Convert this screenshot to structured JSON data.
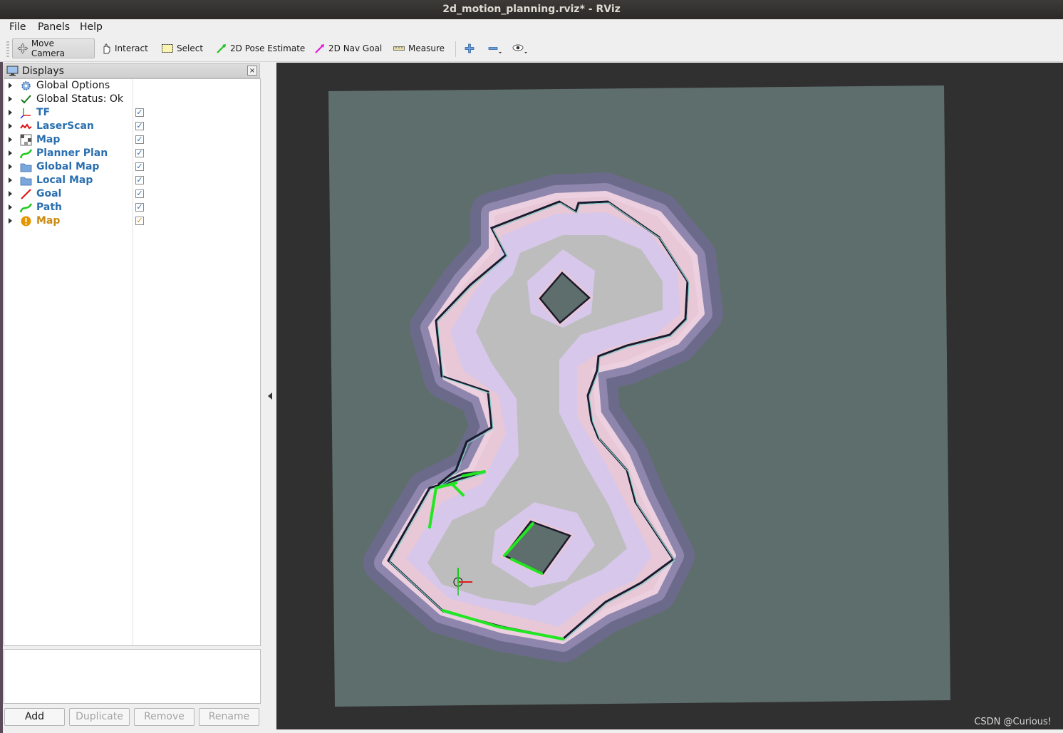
{
  "window": {
    "title": "2d_motion_planning.rviz* - RViz"
  },
  "menu": [
    {
      "label": "File"
    },
    {
      "label": "Panels"
    },
    {
      "label": "Help"
    }
  ],
  "toolbar": {
    "move_camera": "Move Camera",
    "interact": "Interact",
    "select": "Select",
    "pose_estimate": "2D Pose Estimate",
    "nav_goal": "2D Nav Goal",
    "measure": "Measure"
  },
  "displays": {
    "title": "Displays",
    "close": "×",
    "items": [
      {
        "label": "Global Options",
        "icon": "gear-icon",
        "checkbox": false,
        "style": "plain"
      },
      {
        "label": "Global Status: Ok",
        "icon": "check-icon",
        "checkbox": false,
        "style": "plain"
      },
      {
        "label": "TF",
        "icon": "tf-axes-icon",
        "checkbox": true,
        "checked": true,
        "style": "link"
      },
      {
        "label": "LaserScan",
        "icon": "laserscan-icon",
        "checkbox": true,
        "checked": true,
        "style": "link"
      },
      {
        "label": "Map",
        "icon": "map-icon",
        "checkbox": true,
        "checked": true,
        "style": "link"
      },
      {
        "label": "Planner Plan",
        "icon": "path-icon",
        "checkbox": true,
        "checked": true,
        "style": "link"
      },
      {
        "label": "Global Map",
        "icon": "folder-icon",
        "checkbox": true,
        "checked": true,
        "style": "link"
      },
      {
        "label": "Local Map",
        "icon": "folder-icon",
        "checkbox": true,
        "checked": true,
        "style": "link"
      },
      {
        "label": "Goal",
        "icon": "pose-icon",
        "checkbox": true,
        "checked": true,
        "style": "link"
      },
      {
        "label": "Path",
        "icon": "path-icon",
        "checkbox": true,
        "checked": true,
        "style": "link"
      },
      {
        "label": "Map",
        "icon": "warning-icon",
        "checkbox": true,
        "checked": true,
        "style": "warn"
      }
    ]
  },
  "buttons": {
    "add": "Add",
    "duplicate": "Duplicate",
    "remove": "Remove",
    "rename": "Rename"
  },
  "watermark": "CSDN @Curious!",
  "colors": {
    "link": "#2a6fb0",
    "warning": "#c98a10",
    "viewport_bg": "#303030",
    "map_unknown": "#5e6e6c",
    "map_free": "#bdbdbd",
    "inflation": "#d7c7ea",
    "path": "#22e622"
  }
}
